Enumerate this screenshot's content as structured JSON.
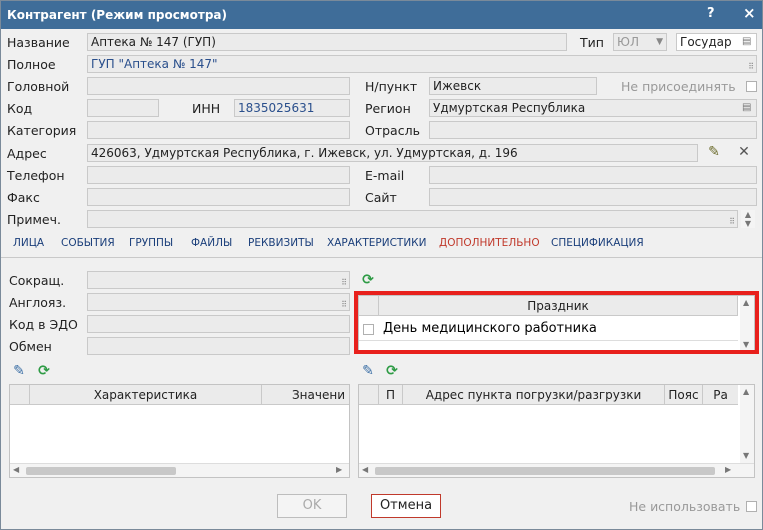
{
  "window": {
    "title": "Контрагент (Режим просмотра)",
    "help_btn": "?",
    "close_btn": "×"
  },
  "form": {
    "name_label": "Название",
    "name_value": "Аптека № 147 (ГУП)",
    "type_label": "Тип",
    "type_value": "ЮЛ",
    "gos_value": "Государ",
    "full_label": "Полное",
    "full_value": "ГУП \"Аптека № 147\"",
    "head_label": "Головной",
    "npunkt_label": "Н/пункт",
    "npunkt_value": "Ижевск",
    "no_join_label": "Не присоединять",
    "code_label": "Код",
    "inn_label": "ИНН",
    "inn_value": "1835025631",
    "region_label": "Регион",
    "region_value": "Удмуртская Республика",
    "category_label": "Категория",
    "branch_label": "Отрасль",
    "address_label": "Адрес",
    "address_value": "426063, Удмуртская Республика, г. Ижевск, ул. Удмуртская, д. 196",
    "phone_label": "Телефон",
    "email_label": "E-mail",
    "fax_label": "Факс",
    "site_label": "Сайт",
    "note_label": "Примеч."
  },
  "tabs": [
    "ЛИЦА",
    "СОБЫТИЯ",
    "ГРУППЫ",
    "ФАЙЛЫ",
    "РЕКВИЗИТЫ",
    "ХАРАКТЕРИСТИКИ",
    "ДОПОЛНИТЕЛЬНО",
    "СПЕЦИФИКАЦИЯ"
  ],
  "extra": {
    "short_label": "Сокращ.",
    "eng_label": "Англояз.",
    "edo_label": "Код в ЭДО",
    "exchange_label": "Обмен"
  },
  "holiday_grid": {
    "header": "Праздник",
    "rows": [
      "День медицинского работника"
    ]
  },
  "char_grid": {
    "col1": "Характеристика",
    "col2": "Значени"
  },
  "addr_grid": {
    "col1": "П",
    "col2": "Адрес пункта погрузки/разгрузки",
    "col3": "Пояс",
    "col4": "Ра"
  },
  "footer": {
    "ok": "OK",
    "cancel": "Отмена",
    "not_use": "Не использовать"
  },
  "colors": {
    "titlebar": "#3f6d99",
    "highlight": "#e8201c",
    "active_tab": "#c0392b",
    "link": "#1a3e7a"
  }
}
